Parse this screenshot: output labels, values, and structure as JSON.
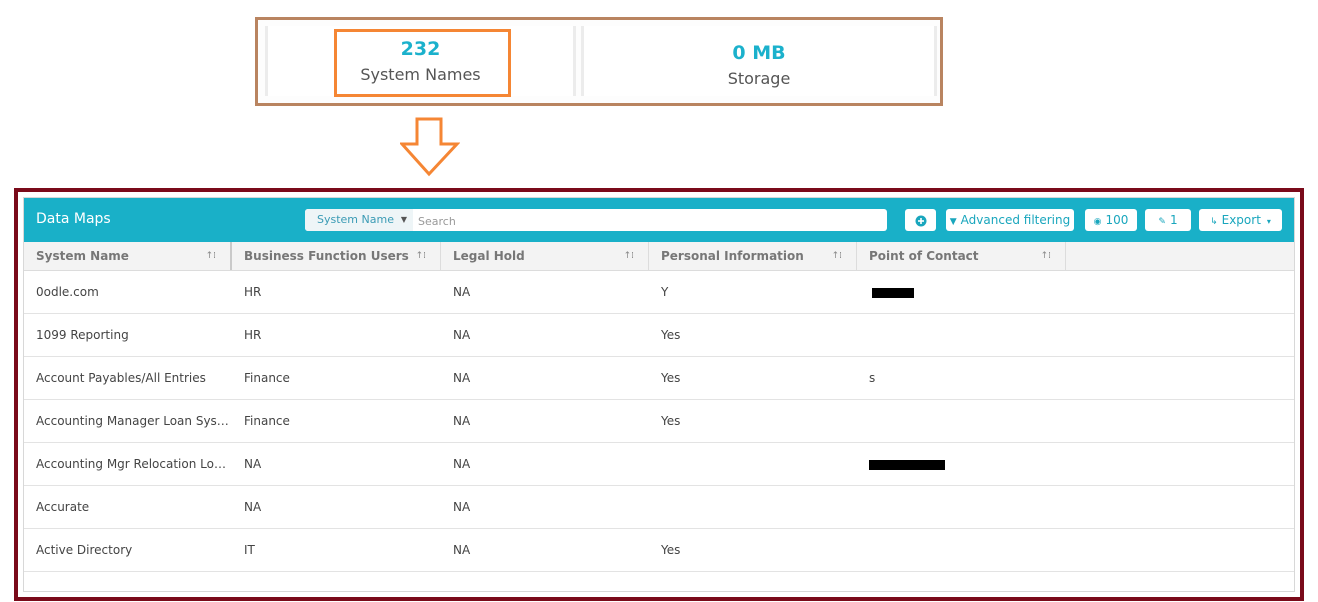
{
  "stats": [
    {
      "value": "232",
      "label": "System Names"
    },
    {
      "value": "0 MB",
      "label": "Storage"
    }
  ],
  "colors": {
    "accent": "#19b0c8",
    "highlight_orange": "#f58634",
    "frame_maroon": "#7a0a1a",
    "frame_brown": "#b98460"
  },
  "data_maps": {
    "title": "Data Maps",
    "search": {
      "field_select": "System Name",
      "placeholder": "Search"
    },
    "buttons": {
      "add_icon": "plus-circle-icon",
      "advanced_filtering": "Advanced filtering",
      "visible_count": "100",
      "pinned_count": "1",
      "export": "Export"
    },
    "columns": [
      "System Name",
      "Business Function Users",
      "Legal Hold",
      "Personal Information",
      "Point of Contact"
    ],
    "rows": [
      [
        "0odle.com",
        "HR",
        "NA",
        "Y",
        ""
      ],
      [
        "1099 Reporting",
        "HR",
        "NA",
        "Yes",
        ""
      ],
      [
        "Account Payables/All Entries",
        "Finance",
        "NA",
        "Yes",
        "s"
      ],
      [
        "Accounting Manager Loan Syste...",
        "Finance",
        "NA",
        "Yes",
        ""
      ],
      [
        "Accounting Mgr Relocation Loa...",
        "NA",
        "NA",
        "",
        ""
      ],
      [
        "Accurate",
        "NA",
        "NA",
        "",
        ""
      ],
      [
        "Active Directory",
        "IT",
        "NA",
        "Yes",
        ""
      ]
    ]
  }
}
